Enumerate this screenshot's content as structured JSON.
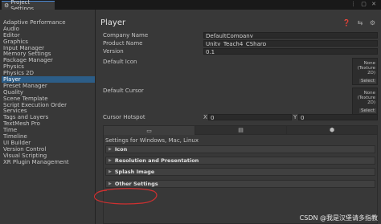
{
  "window": {
    "tab_label": "Project Settings",
    "tab_icon": "gear-icon",
    "controls": "⋮ ▢ ✕"
  },
  "sidebar": {
    "items": [
      {
        "label": "Adaptive Performance"
      },
      {
        "label": "Audio"
      },
      {
        "label": "Editor"
      },
      {
        "label": "Graphics"
      },
      {
        "label": "Input Manager"
      },
      {
        "label": "Memory Settings"
      },
      {
        "label": "Package Manager"
      },
      {
        "label": "Physics"
      },
      {
        "label": "Physics 2D"
      },
      {
        "label": "Player",
        "selected": true
      },
      {
        "label": "Preset Manager"
      },
      {
        "label": "Quality"
      },
      {
        "label": "Scene Template"
      },
      {
        "label": "Script Execution Order"
      },
      {
        "label": "Services"
      },
      {
        "label": "Tags and Layers"
      },
      {
        "label": "TextMesh Pro"
      },
      {
        "label": "Time"
      },
      {
        "label": "Timeline"
      },
      {
        "label": "UI Builder"
      },
      {
        "label": "Version Control"
      },
      {
        "label": "Visual Scripting"
      },
      {
        "label": "XR Plugin Management"
      }
    ]
  },
  "header": {
    "title": "Player",
    "icons": "❓ ⇆ ⚙"
  },
  "fields": {
    "company_name": {
      "label": "Company Name",
      "value": "DefaultCompany"
    },
    "product_name": {
      "label": "Product Name",
      "value": "Unity_Teach4_CSharp"
    },
    "version": {
      "label": "Version",
      "value": "0.1"
    },
    "default_icon": {
      "label": "Default Icon",
      "none_text": "None",
      "type_text": "(Texture 2D)",
      "select_label": "Select"
    },
    "default_cursor": {
      "label": "Default Cursor",
      "none_text": "None",
      "type_text": "(Texture 2D)",
      "select_label": "Select"
    },
    "cursor_hotspot": {
      "label": "Cursor Hotspot",
      "x_label": "X",
      "x_value": "0",
      "y_label": "Y",
      "y_value": "0"
    }
  },
  "platform": {
    "tabs": [
      {
        "icon": "monitor-icon",
        "glyph": "▭",
        "active": true
      },
      {
        "icon": "server-icon",
        "glyph": "▤",
        "active": false
      },
      {
        "icon": "android-icon",
        "glyph": "⬢",
        "active": false
      }
    ],
    "settings_label": "Settings for Windows, Mac, Linux",
    "sections": [
      {
        "label": "Icon"
      },
      {
        "label": "Resolution and Presentation"
      },
      {
        "label": "Splash Image"
      },
      {
        "label": "Other Settings"
      }
    ]
  },
  "annotation_color": "#d03030",
  "watermark": "CSDN @我是汉堡请多指教"
}
